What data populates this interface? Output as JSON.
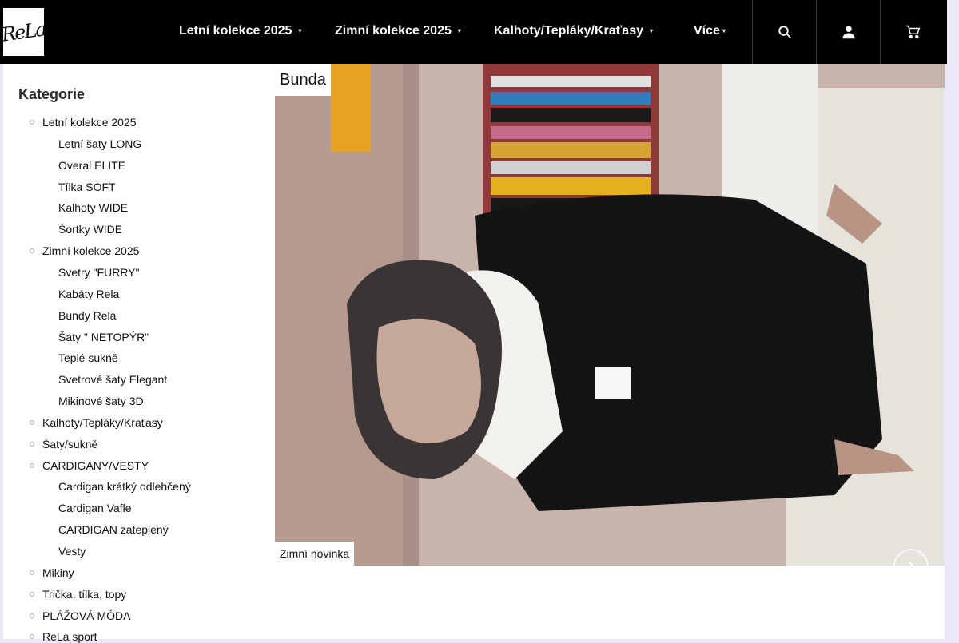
{
  "header": {
    "logo_text": "ReLa",
    "nav": [
      {
        "label": "Letní kolekce 2025"
      },
      {
        "label": "Zimní kolekce 2025"
      },
      {
        "label": "Kalhoty/Tepláky/Kraťasy"
      },
      {
        "label": "Více"
      }
    ],
    "icons": [
      "search-icon",
      "user-icon",
      "cart-icon"
    ]
  },
  "sidebar": {
    "title": "Kategorie",
    "items": [
      {
        "label": "Letní kolekce 2025",
        "level": 1
      },
      {
        "label": "Letní šaty LONG",
        "level": 2
      },
      {
        "label": "Overal ELITE",
        "level": 2
      },
      {
        "label": "Tílka SOFT",
        "level": 2
      },
      {
        "label": "Kalhoty WIDE",
        "level": 2
      },
      {
        "label": "Šortky WIDE",
        "level": 2
      },
      {
        "label": "Zimní kolekce 2025",
        "level": 1
      },
      {
        "label": "Svetry \"FURRY\"",
        "level": 2
      },
      {
        "label": "Kabáty Rela",
        "level": 2
      },
      {
        "label": "Bundy Rela",
        "level": 2
      },
      {
        "label": "Šaty \" NETOPÝR\"",
        "level": 2
      },
      {
        "label": "Teplé sukně",
        "level": 2
      },
      {
        "label": "Svetrové šaty Elegant",
        "level": 2
      },
      {
        "label": "Mikinové šaty 3D",
        "level": 2
      },
      {
        "label": "Kalhoty/Tepláky/Kraťasy",
        "level": 1
      },
      {
        "label": "Šaty/sukně",
        "level": 1
      },
      {
        "label": "CARDIGANY/VESTY",
        "level": 1
      },
      {
        "label": "Cardigan krátký odlehčený",
        "level": 2
      },
      {
        "label": "Cardigan Vafle",
        "level": 2
      },
      {
        "label": "CARDIGAN zateplený",
        "level": 2
      },
      {
        "label": "Vesty",
        "level": 2
      },
      {
        "label": "Mikiny",
        "level": 1
      },
      {
        "label": "Trička, tílka, topy",
        "level": 1
      },
      {
        "label": "PLÁŽOVÁ MÓDA",
        "level": 1
      },
      {
        "label": "ReLa sport",
        "level": 1
      }
    ]
  },
  "hero": {
    "top_label": "Bunda",
    "bottom_label": "Zimní novinka"
  }
}
